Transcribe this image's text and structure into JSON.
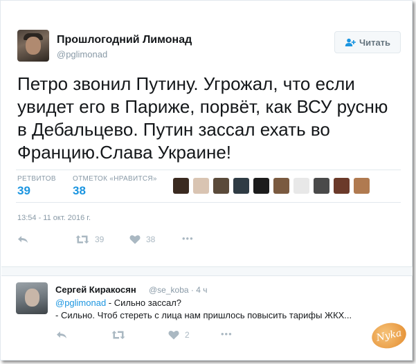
{
  "author": {
    "name": "Прошлогодний Лимонад",
    "handle": "@pglimonad"
  },
  "follow_button": {
    "label": "Читать",
    "icon": "user-plus-icon"
  },
  "tweet": {
    "lines": [
      "Петро звонил Путину. Угрожал, что если",
      "увидет его в Париже, порвёт, как ВСУ русню",
      "в Дебальцево. Путин зассал ехать во",
      "Францию.Слава Украине!"
    ],
    "timestamp": "13:54 - 11 окт. 2016 г."
  },
  "stats": {
    "retweets_label": "РЕТВИТОВ",
    "retweets_value": "39",
    "likes_label": "ОТМЕТОК «НРАВИТСЯ»",
    "likes_value": "38"
  },
  "likers_colors": [
    "#3a2a20",
    "#d9c4b2",
    "#5a4a3a",
    "#2f3b44",
    "#1c1c1c",
    "#7a5a40",
    "#e8e8e8",
    "#4a4a4a",
    "#6b3a2a",
    "#b07a50"
  ],
  "actions": {
    "retweet_count": "39",
    "like_count": "38",
    "more_label": "•••"
  },
  "reply": {
    "name": "Сергей Киракосян",
    "handle": "@se_koba",
    "age": "4 ч",
    "mention": "@pglimonad",
    "line1_rest": " - Сильно зассал?",
    "line2": "- Сильно. Чтоб стереть с лица нам пришлось повысить тарифы ЖКХ...",
    "like_count": "2"
  },
  "watermark": {
    "text": "Nyka"
  },
  "colors": {
    "accent": "#1b95e0",
    "muted": "#8899a6",
    "border": "#e1e8ed"
  }
}
